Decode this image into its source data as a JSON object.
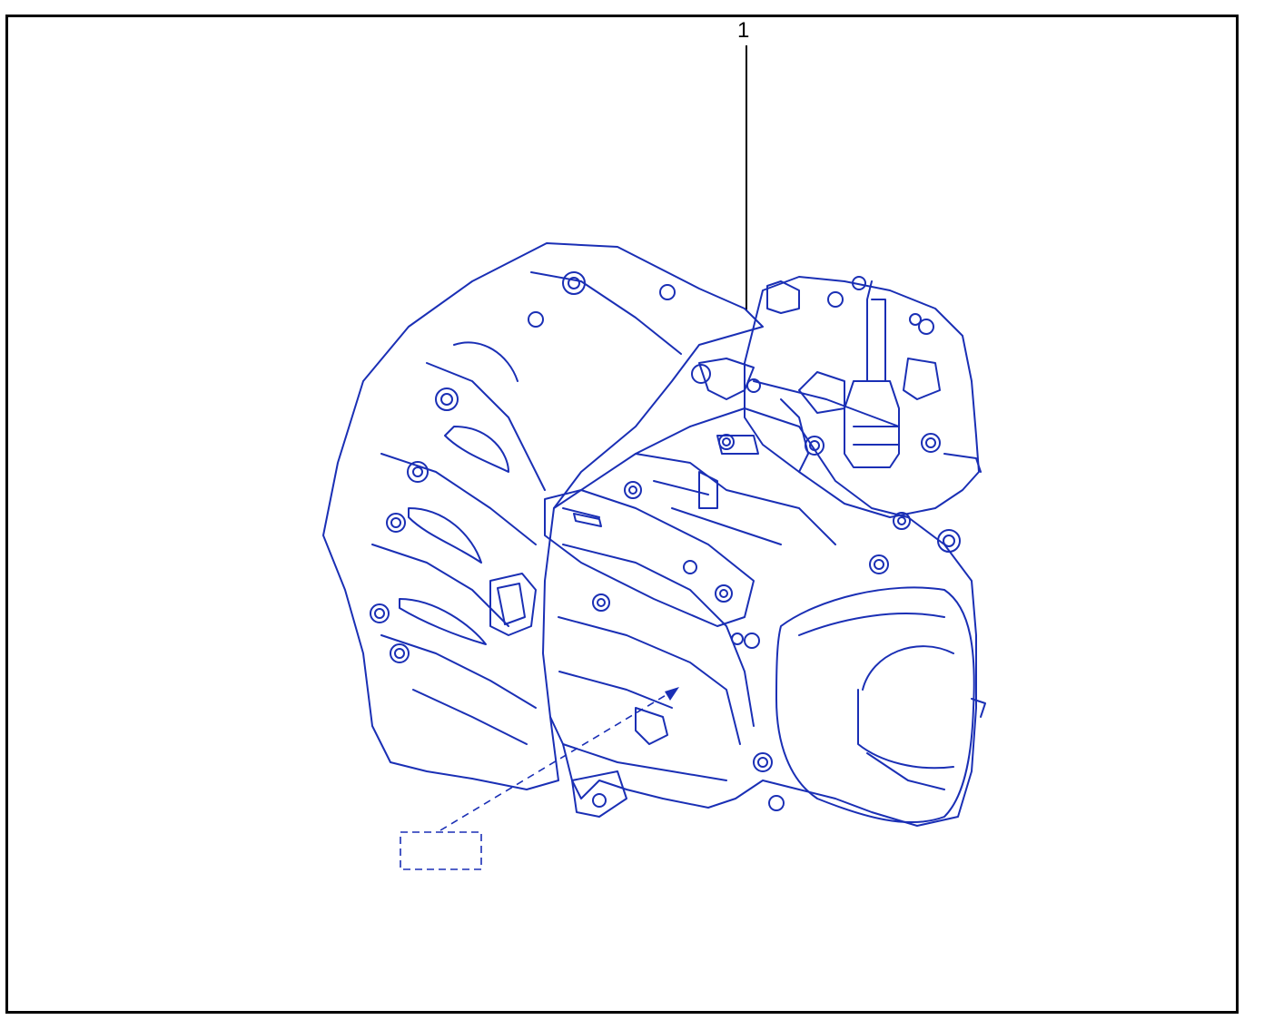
{
  "diagram": {
    "callouts": [
      {
        "number": "1"
      }
    ],
    "colors": {
      "frame": "#000000",
      "leader": "#000000",
      "drawing": "#1a2fb5"
    },
    "icons": [
      "gearbox-illustration",
      "label-placeholder-box"
    ]
  }
}
